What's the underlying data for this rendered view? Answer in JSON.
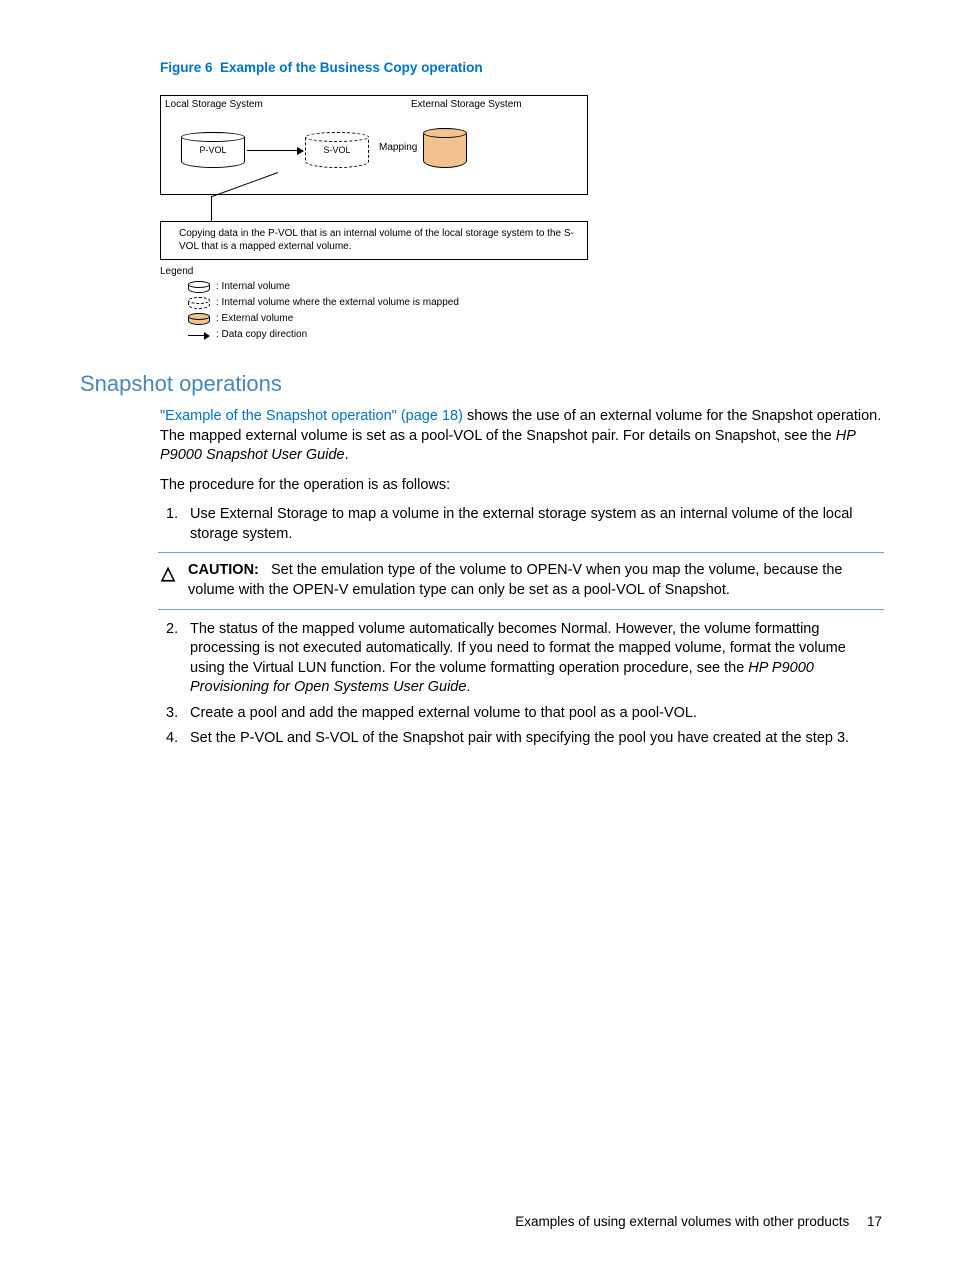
{
  "figure": {
    "label": "Figure 6",
    "title": "Example of the Business Copy operation",
    "diagram": {
      "local_label": "Local Storage System",
      "external_label": "External Storage System",
      "pvol": "P-VOL",
      "svol": "S-VOL",
      "mapping": "Mapping",
      "note": "Copying data in the P-VOL that is an internal volume of the local storage system to the S-VOL that is a mapped external volume."
    },
    "legend": {
      "title": "Legend",
      "items": [
        ": Internal volume",
        ": Internal volume where the external volume is mapped",
        ": External volume",
        " : Data copy direction"
      ]
    }
  },
  "section": {
    "heading": "Snapshot operations",
    "intro_link": "\"Example of the Snapshot operation\" (page 18)",
    "intro_rest": " shows the use of an external volume for the Snapshot operation. The mapped external volume is set as a pool-VOL of the Snapshot pair. For details on Snapshot, see the ",
    "intro_italic": "HP P9000 Snapshot User Guide",
    "intro_end": ".",
    "procedure_lead": "The procedure for the operation is as follows:",
    "steps": {
      "s1": "Use External Storage to map a volume in the external storage system as an internal volume of the local storage system.",
      "s2a": "The status of the mapped volume automatically becomes Normal. However, the volume formatting processing is not executed automatically. If you need to format the mapped volume, format the volume using the Virtual LUN function. For the volume formatting operation procedure, see the ",
      "s2b": "HP P9000 Provisioning for Open Systems User Guide",
      "s2c": ".",
      "s3": "Create a pool and add the mapped external volume to that pool as a pool-VOL.",
      "s4": "Set the P-VOL and S-VOL of the Snapshot pair with specifying the pool you have created at the step 3."
    },
    "caution": {
      "label": "CAUTION:",
      "text": "Set the emulation type of the volume to OPEN-V when you map the volume, because the volume with the OPEN-V emulation type can only be set as a pool-VOL of Snapshot."
    },
    "numbers": {
      "n1": "1.",
      "n2": "2.",
      "n3": "3.",
      "n4": "4."
    }
  },
  "footer": {
    "text": "Examples of using external volumes with other products",
    "page": "17"
  }
}
